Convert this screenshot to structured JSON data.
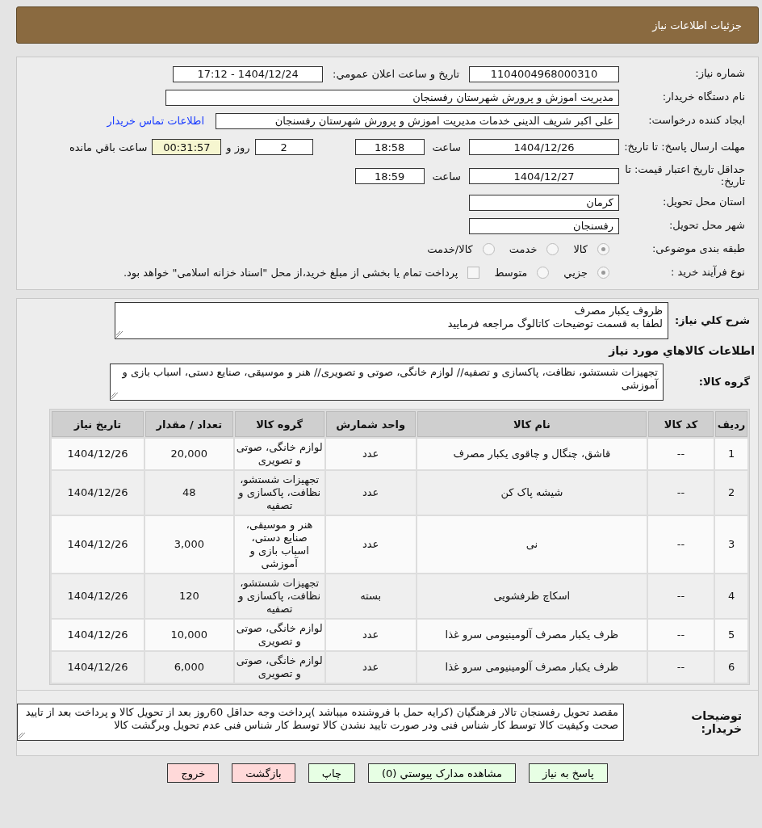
{
  "header": {
    "title": "جزئیات اطلاعات نیاز"
  },
  "need_number": {
    "label": "شماره نیاز:",
    "value": "1104004968000310"
  },
  "announce": {
    "label": "تاریخ و ساعت اعلان عمومي:",
    "value": "1404/12/24 - 17:12"
  },
  "buyer": {
    "label": "نام دستگاه خریدار:",
    "value": "مدیریت اموزش و پرورش شهرستان رفسنجان"
  },
  "requester": {
    "label": "ایجاد کننده درخواست:",
    "value": "علی اکبر شریف الدینی خدمات مدیریت اموزش و پرورش شهرستان رفسنجان",
    "link": "اطلاعات تماس خریدار"
  },
  "deadline": {
    "label": "مهلت ارسال پاسخ: تا تاریخ:",
    "date": "1404/12/26",
    "time_label": "ساعت",
    "time": "18:58",
    "days": "2",
    "days_label": "روز و",
    "remaining": "00:31:57",
    "remaining_label": "ساعت باقي مانده"
  },
  "validity": {
    "label": "حداقل تاریخ اعتبار قیمت: تا تاریخ:",
    "date": "1404/12/27",
    "time_label": "ساعت",
    "time": "18:59"
  },
  "province": {
    "label": "استان محل تحویل:",
    "value": "کرمان"
  },
  "city": {
    "label": "شهر محل تحویل:",
    "value": "رفسنجان"
  },
  "category": {
    "label": "طبقه بندی موضوعی:",
    "options": [
      {
        "label": "کالا",
        "selected": true
      },
      {
        "label": "خدمت",
        "selected": false
      },
      {
        "label": "کالا/خدمت",
        "selected": false
      }
    ]
  },
  "process": {
    "label": "نوع فرآیند خرید :",
    "options": [
      {
        "label": "جزيي",
        "selected": true
      },
      {
        "label": "متوسط",
        "selected": false
      }
    ],
    "checkbox": {
      "label": "پرداخت تمام یا بخشی از مبلغ خرید،از محل \"اسناد خزانه اسلامی\" خواهد بود.",
      "checked": false
    }
  },
  "description": {
    "label": "شرح کلي نیاز:",
    "lines": [
      "ظروف یکبار مصرف",
      "لطفا به قسمت توضیحات کاتالوگ مراجعه فرمایید"
    ]
  },
  "goods_title": "اطلاعات کالاهاي مورد نیاز",
  "goods_group": {
    "label": "گروه کالا:",
    "value": "تجهیزات شستشو، نظافت، پاکسازی و تصفیه// لوازم خانگی، صوتی و تصویری// هنر و موسیقی، صنایع دستی، اسباب بازی و آموزشی"
  },
  "table": {
    "columns": [
      "ردیف",
      "کد کالا",
      "نام کالا",
      "واحد شمارش",
      "گروه کالا",
      "تعداد / مقدار",
      "تاریخ نیاز"
    ],
    "rows": [
      [
        "1",
        "--",
        "قاشق، چنگال و چاقوی یکبار مصرف",
        "عدد",
        "لوازم خانگی، صوتی و تصویری",
        "20,000",
        "1404/12/26"
      ],
      [
        "2",
        "--",
        "شیشه پاک کن",
        "عدد",
        "تجهیزات شستشو، نظافت، پاکسازی و تصفیه",
        "48",
        "1404/12/26"
      ],
      [
        "3",
        "--",
        "نی",
        "عدد",
        "هنر و موسیقی، صنایع دستی، اسباب بازی و آموزشی",
        "3,000",
        "1404/12/26"
      ],
      [
        "4",
        "--",
        "اسکاچ ظرفشویی",
        "بسته",
        "تجهیزات شستشو، نظافت، پاکسازی و تصفیه",
        "120",
        "1404/12/26"
      ],
      [
        "5",
        "--",
        "ظرف یکبار مصرف آلومینیومی سرو غذا",
        "عدد",
        "لوازم خانگی، صوتی و تصویری",
        "10,000",
        "1404/12/26"
      ],
      [
        "6",
        "--",
        "ظرف یکبار مصرف آلومینیومی سرو غذا",
        "عدد",
        "لوازم خانگی، صوتی و تصویری",
        "6,000",
        "1404/12/26"
      ]
    ]
  },
  "buyer_notes": {
    "label": "توضیحات خریدار:",
    "value": "مقصد تحویل رفسنجان تالار فرهنگیان (کرایه حمل با فروشنده میباشد )پرداخت وجه حداقل 60روز بعد از تحویل کالا و پرداخت بعد از تایید صحت وکیفیت کالا توسط کار شناس فنی ودر صورت تایید نشدن کالا توسط کار شناس فنی عدم تحویل وبرگشت کالا"
  },
  "buttons": [
    {
      "label": "پاسخ به نیاز",
      "kind": "green"
    },
    {
      "label": "مشاهده مدارک پیوستي (0)",
      "kind": "green"
    },
    {
      "label": "چاپ",
      "kind": "green"
    },
    {
      "label": "بازگشت",
      "kind": "red"
    },
    {
      "label": "خروج",
      "kind": "red"
    }
  ]
}
